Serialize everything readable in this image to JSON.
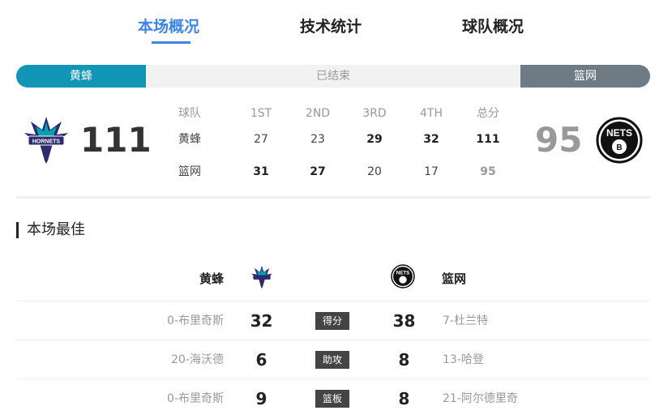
{
  "tabs": [
    {
      "label": "本场概况",
      "active": true
    },
    {
      "label": "技术统计",
      "active": false
    },
    {
      "label": "球队概况",
      "active": false
    }
  ],
  "status": {
    "home_team": "黄蜂",
    "state": "已结束",
    "away_team": "篮网"
  },
  "scoreboard": {
    "home_score": "111",
    "away_score": "95",
    "header": [
      "球队",
      "1ST",
      "2ND",
      "3RD",
      "4TH",
      "总分"
    ],
    "rows": [
      {
        "team": "黄蜂",
        "q1": "27",
        "q2": "23",
        "q3": "29",
        "q4": "32",
        "total": "111"
      },
      {
        "team": "篮网",
        "q1": "31",
        "q2": "27",
        "q3": "20",
        "q4": "17",
        "total": "95"
      }
    ]
  },
  "best": {
    "title": "本场最佳",
    "home_team": "黄蜂",
    "away_team": "篮网",
    "rows": [
      {
        "home_player": "0-布里奇斯",
        "home_value": "32",
        "label": "得分",
        "away_value": "38",
        "away_player": "7-杜兰特"
      },
      {
        "home_player": "20-海沃德",
        "home_value": "6",
        "label": "助攻",
        "away_value": "8",
        "away_player": "13-哈登"
      },
      {
        "home_player": "0-布里奇斯",
        "home_value": "9",
        "label": "篮板",
        "away_value": "8",
        "away_player": "21-阿尔德里奇"
      }
    ]
  },
  "colors": {
    "accent": "#3c86e6",
    "home": "#1196b5",
    "away": "#6e7b85",
    "hornets_purple": "#2d2a6e",
    "hornets_teal": "#00a3b4"
  },
  "icons": {
    "home_logo": "hornets-logo-icon",
    "away_logo": "nets-logo-icon"
  }
}
